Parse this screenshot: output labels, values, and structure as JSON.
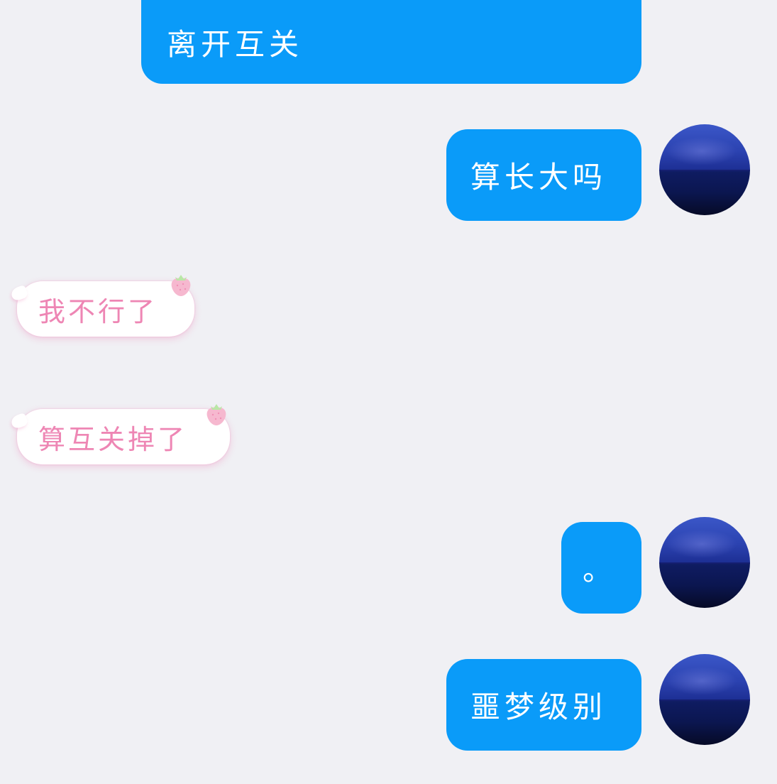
{
  "conversation": {
    "messages": [
      {
        "side": "outgoing",
        "text": "离开互关"
      },
      {
        "side": "outgoing",
        "text": "算长大吗"
      },
      {
        "side": "incoming",
        "text": "我不行了"
      },
      {
        "side": "incoming",
        "text": "算互关掉了"
      },
      {
        "side": "outgoing",
        "text": "。"
      },
      {
        "side": "outgoing",
        "text": "噩梦级别"
      }
    ]
  },
  "theme": {
    "background": "#f0f0f4",
    "outgoing_bubble": "#0a9bf9",
    "outgoing_text": "#ffffff",
    "incoming_bubble": "#ffffff",
    "incoming_text": "#ee86b4"
  },
  "icons": {
    "bubble_decoration": "strawberry-icon",
    "avatar": "night-sea-avatar"
  }
}
